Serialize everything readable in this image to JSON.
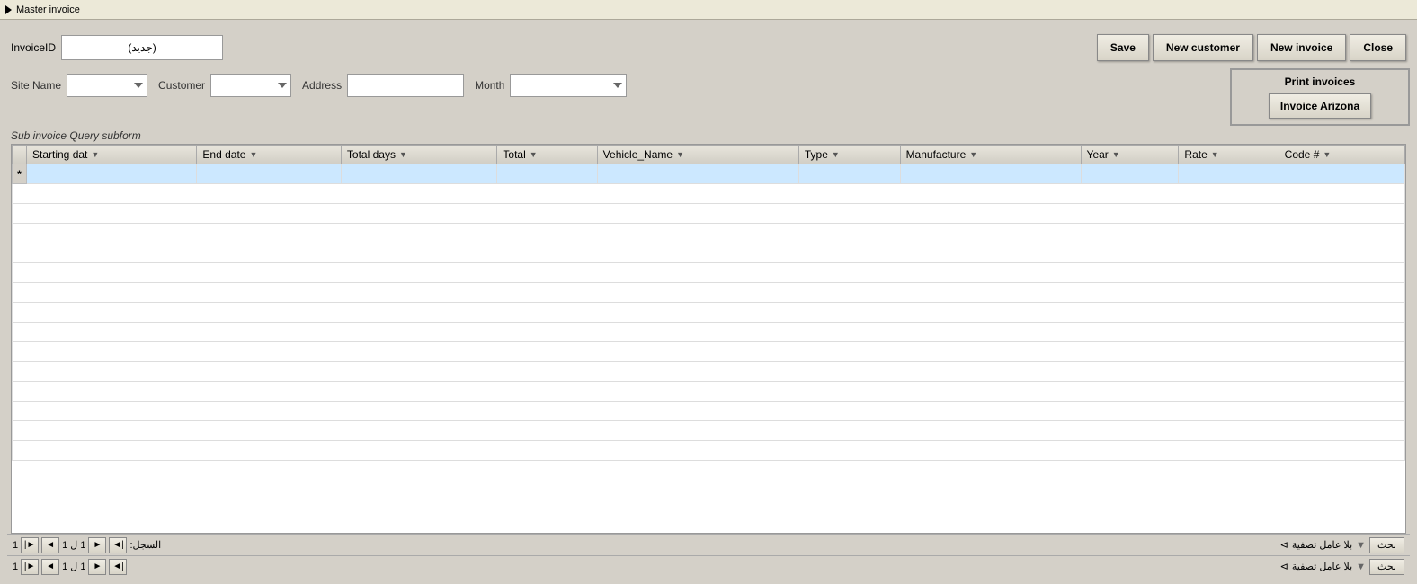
{
  "window": {
    "title": "Master invoice"
  },
  "header": {
    "invoice_id_label": "InvoiceID",
    "invoice_id_value": "(جديد)",
    "save_label": "Save",
    "new_customer_label": "New customer",
    "new_invoice_label": "New invoice",
    "close_label": "Close"
  },
  "form": {
    "site_name_label": "Site Name",
    "customer_label": "Customer",
    "address_label": "Address",
    "month_label": "Month"
  },
  "print": {
    "title": "Print invoices",
    "invoice_arizona_label": "Invoice Arizona"
  },
  "subform": {
    "title": "Sub invoice Query subform"
  },
  "table": {
    "columns": [
      {
        "id": "starting_date",
        "label": "Starting dat"
      },
      {
        "id": "end_date",
        "label": "End date"
      },
      {
        "id": "total_days",
        "label": "Total days"
      },
      {
        "id": "total",
        "label": "Total"
      },
      {
        "id": "vehicle_name",
        "label": "Vehicle_Name"
      },
      {
        "id": "type",
        "label": "Type"
      },
      {
        "id": "manufacture",
        "label": "Manufacture"
      },
      {
        "id": "year",
        "label": "Year"
      },
      {
        "id": "rate",
        "label": "Rate"
      },
      {
        "id": "code_num",
        "label": "Code #"
      }
    ],
    "rows": []
  },
  "bottom_bar": {
    "record_label": "السجل:",
    "of_label": "1 ل 1",
    "page_label": "1",
    "no_filter_label": "بلا عامل تصفية",
    "search_label": "بحث"
  },
  "status_bar": {
    "no_filter_label": "بلا عامل تصفية",
    "search_label": "بحث"
  }
}
